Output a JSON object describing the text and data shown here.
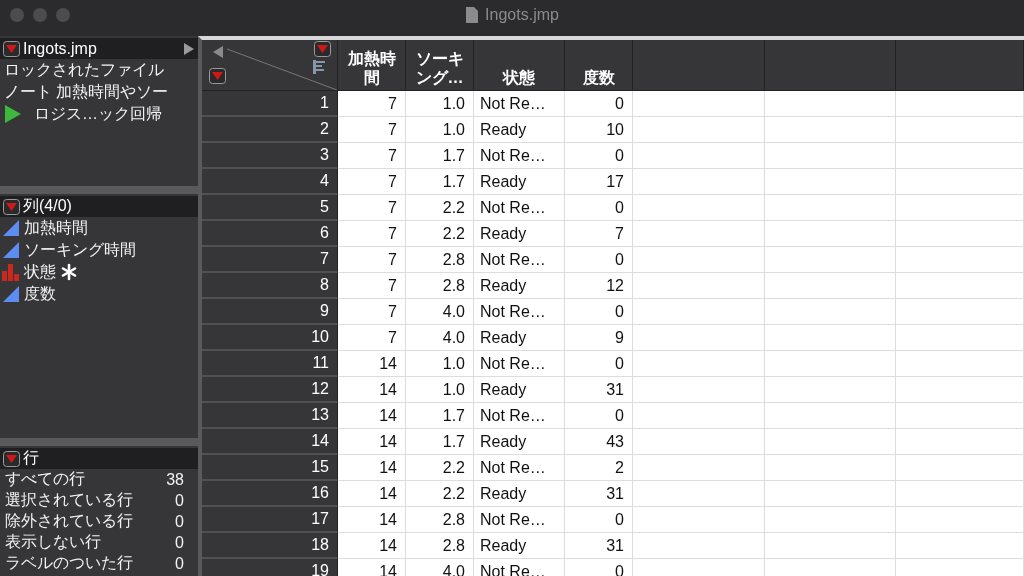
{
  "window": {
    "title": "Ingots.jmp"
  },
  "table_panel": {
    "title": "Ingots.jmp",
    "items": [
      {
        "kind": "text",
        "label": "ロックされたファイル"
      },
      {
        "kind": "text",
        "label": "ノート  加熱時間やソー"
      },
      {
        "kind": "script",
        "label": "ロジス…ック回帰"
      }
    ]
  },
  "columns_panel": {
    "title": "列(4/0)",
    "items": [
      {
        "kind": "continuous",
        "label": "加熱時間",
        "marked": false
      },
      {
        "kind": "continuous",
        "label": "ソーキング時間",
        "marked": false
      },
      {
        "kind": "nominal",
        "label": "状態",
        "marked": true
      },
      {
        "kind": "continuous",
        "label": "度数",
        "marked": false
      }
    ]
  },
  "rows_panel": {
    "title": "行",
    "items": [
      {
        "label": "すべての行",
        "count": "38"
      },
      {
        "label": "選択されている行",
        "count": "0"
      },
      {
        "label": "除外されている行",
        "count": "0"
      },
      {
        "label": "表示しない行",
        "count": "0"
      },
      {
        "label": "ラベルのついた行",
        "count": "0"
      }
    ]
  },
  "table": {
    "columns": [
      "",
      "加熱時間",
      "ソーキング…",
      "状態",
      "度数"
    ],
    "rows": [
      [
        "1",
        "7",
        "1.0",
        "Not Re…",
        "0"
      ],
      [
        "2",
        "7",
        "1.0",
        "Ready",
        "10"
      ],
      [
        "3",
        "7",
        "1.7",
        "Not Re…",
        "0"
      ],
      [
        "4",
        "7",
        "1.7",
        "Ready",
        "17"
      ],
      [
        "5",
        "7",
        "2.2",
        "Not Re…",
        "0"
      ],
      [
        "6",
        "7",
        "2.2",
        "Ready",
        "7"
      ],
      [
        "7",
        "7",
        "2.8",
        "Not Re…",
        "0"
      ],
      [
        "8",
        "7",
        "2.8",
        "Ready",
        "12"
      ],
      [
        "9",
        "7",
        "4.0",
        "Not Re…",
        "0"
      ],
      [
        "10",
        "7",
        "4.0",
        "Ready",
        "9"
      ],
      [
        "11",
        "14",
        "1.0",
        "Not Re…",
        "0"
      ],
      [
        "12",
        "14",
        "1.0",
        "Ready",
        "31"
      ],
      [
        "13",
        "14",
        "1.7",
        "Not Re…",
        "0"
      ],
      [
        "14",
        "14",
        "1.7",
        "Ready",
        "43"
      ],
      [
        "15",
        "14",
        "2.2",
        "Not Re…",
        "2"
      ],
      [
        "16",
        "14",
        "2.2",
        "Ready",
        "31"
      ],
      [
        "17",
        "14",
        "2.8",
        "Not Re…",
        "0"
      ],
      [
        "18",
        "14",
        "2.8",
        "Ready",
        "31"
      ],
      [
        "19",
        "14",
        "4.0",
        "Not Re…",
        "0"
      ]
    ]
  }
}
